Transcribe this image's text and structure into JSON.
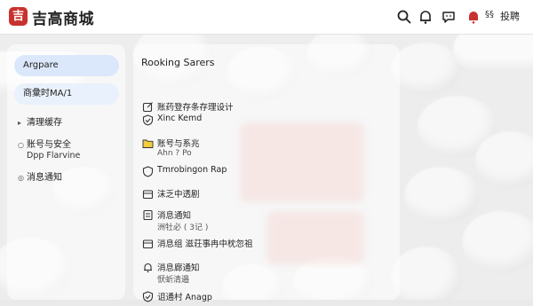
{
  "header": {
    "logo_glyph": "吉",
    "title": "吉高商城",
    "badge_text": "§§",
    "auth_label": "投聘",
    "brand_color": "#c8322e",
    "icons": [
      "search-icon",
      "bell-icon",
      "chat-icon",
      "notification-icon"
    ]
  },
  "sidebar": {
    "top_button": "Argpare",
    "second_button": "商彙时MA/1",
    "items": [
      {
        "label": "清理缓存",
        "marker": "▸"
      },
      {
        "label": "账号与安全",
        "marker": "○",
        "sub": "Dpp Flarvine"
      },
      {
        "label": "消息通知",
        "marker": "◎"
      }
    ]
  },
  "main": {
    "title": "Rooking Sarers",
    "rows": [
      {
        "icon": "edit-icon",
        "title": "账药登存条存理设计",
        "sub": ""
      },
      {
        "icon": "check-shield-icon",
        "title": "Xinc Kemd",
        "sub": ""
      },
      {
        "icon": "folder-icon",
        "title": "账号与系兆",
        "sub": "Ahn ? Po"
      },
      {
        "icon": "shield-icon",
        "title": "Tmrobingon Rap",
        "sub": ""
      },
      {
        "icon": "tray-icon",
        "title": "沫乏中透剧",
        "sub": ""
      },
      {
        "icon": "doc-icon",
        "title": "消息通知",
        "sub": "洲牡必 ( 3记 )"
      },
      {
        "icon": "tray-icon",
        "title": "消息组 滋荘事冉中枕忽祖",
        "sub": ""
      },
      {
        "icon": "bell-icon",
        "title": "消息廊通知",
        "sub": "恹蚚清邉"
      },
      {
        "icon": "check-shield-icon",
        "title": "诅通村 Anagp",
        "sub": ""
      }
    ]
  }
}
